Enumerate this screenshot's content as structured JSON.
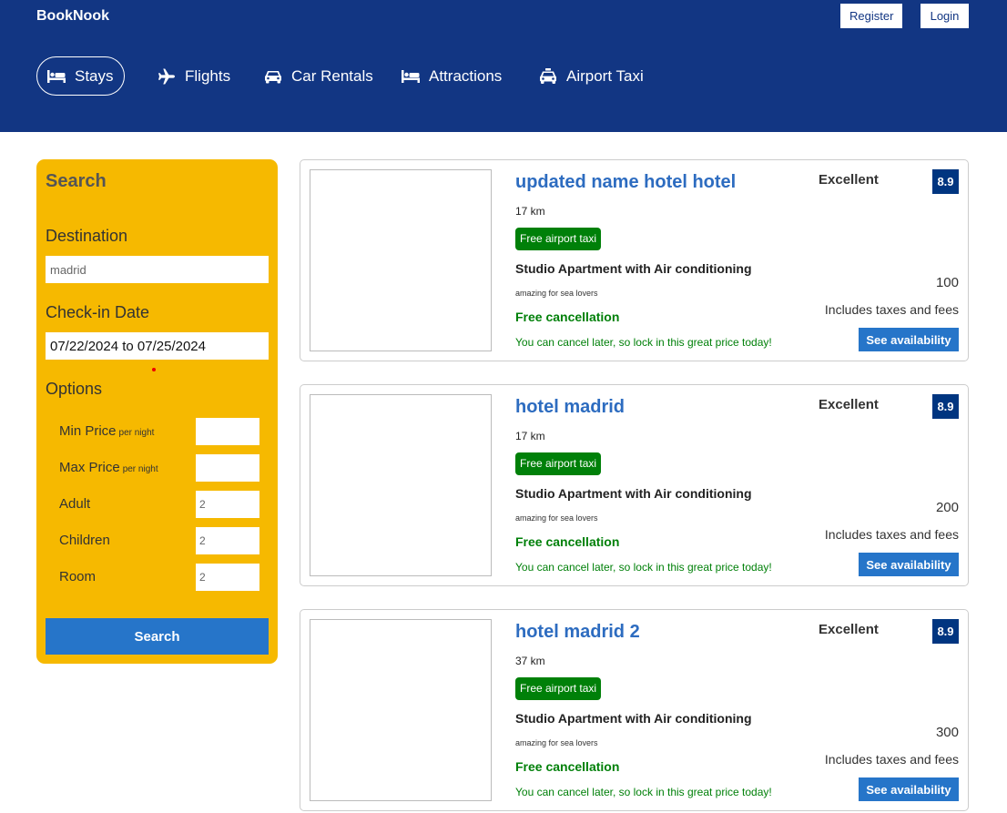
{
  "header": {
    "logo": "BookNook",
    "register_label": "Register",
    "login_label": "Login",
    "nav": [
      {
        "label": "Stays",
        "icon": "bed-icon",
        "active": true
      },
      {
        "label": "Flights",
        "icon": "plane-icon",
        "active": false
      },
      {
        "label": "Car Rentals",
        "icon": "car-icon",
        "active": false
      },
      {
        "label": "Attractions",
        "icon": "bed-icon",
        "active": false
      },
      {
        "label": "Airport Taxi",
        "icon": "taxi-icon",
        "active": false
      }
    ]
  },
  "search": {
    "title": "Search",
    "destination_label": "Destination",
    "destination_value": "madrid",
    "checkin_label": "Check-in Date",
    "checkin_value": "07/22/2024 to 07/25/2024",
    "options_label": "Options",
    "per_night": "per night",
    "options": [
      {
        "label": "Min Price",
        "per_night": true,
        "value": ""
      },
      {
        "label": "Max Price",
        "per_night": true,
        "value": ""
      },
      {
        "label": "Adult",
        "per_night": false,
        "value": "2"
      },
      {
        "label": "Children",
        "per_night": false,
        "value": "2"
      },
      {
        "label": "Room",
        "per_night": false,
        "value": "2"
      }
    ],
    "button_label": "Search"
  },
  "results": [
    {
      "name": "updated name hotel hotel",
      "distance": "17 km",
      "taxi": "Free airport taxi",
      "room": "Studio Apartment with Air conditioning",
      "desc": "amazing for sea lovers",
      "cancel": "Free cancellation",
      "cancel_sub": "You can cancel later, so lock in this great price today!",
      "rating_text": "Excellent",
      "rating": "8.9",
      "price": "100",
      "tax": "Includes taxes and fees",
      "button": "See availability"
    },
    {
      "name": "hotel madrid",
      "distance": "17 km",
      "taxi": "Free airport taxi",
      "room": "Studio Apartment with Air conditioning",
      "desc": "amazing for sea lovers",
      "cancel": "Free cancellation",
      "cancel_sub": "You can cancel later, so lock in this great price today!",
      "rating_text": "Excellent",
      "rating": "8.9",
      "price": "200",
      "tax": "Includes taxes and fees",
      "button": "See availability"
    },
    {
      "name": "hotel madrid 2",
      "distance": "37 km",
      "taxi": "Free airport taxi",
      "room": "Studio Apartment with Air conditioning",
      "desc": "amazing for sea lovers",
      "cancel": "Free cancellation",
      "cancel_sub": "You can cancel later, so lock in this great price today!",
      "rating_text": "Excellent",
      "rating": "8.9",
      "price": "300",
      "tax": "Includes taxes and fees",
      "button": "See availability"
    }
  ],
  "colors": {
    "header_bg": "#123683",
    "sidebar_bg": "#f6b900",
    "accent_blue": "#2675c9",
    "green": "#008009",
    "rating_bg": "#003580"
  }
}
